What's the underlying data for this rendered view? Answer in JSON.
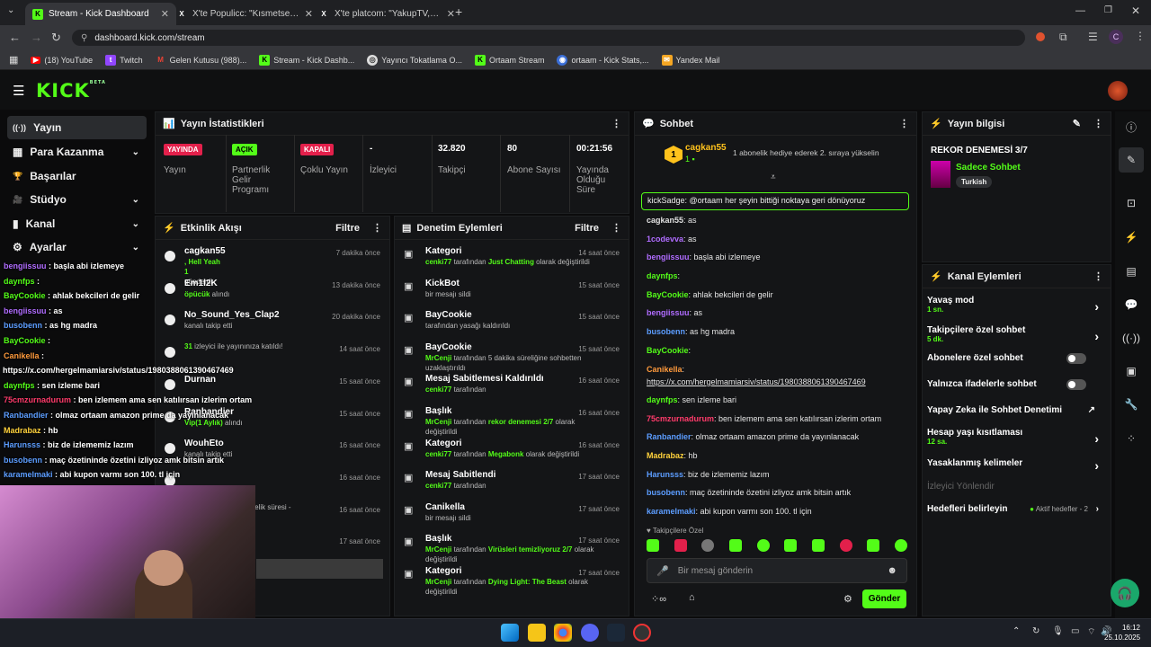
{
  "browser": {
    "tabs": [
      {
        "title": "Stream - Kick Dashboard",
        "close": "✕"
      },
      {
        "title": "X'te Populicc: \"Kısmetse Olur'u...",
        "close": "✕"
      },
      {
        "title": "X'te platcom: \"YakupTV, 120 bi...",
        "close": "✕"
      }
    ],
    "new_tab": "+",
    "url": "dashboard.kick.com/stream",
    "profile": "C",
    "bookmarks": [
      "(18) YouTube",
      "Twitch",
      "Gelen Kutusu (988)...",
      "Stream - Kick Dashb...",
      "Yayıncı Tokatlama O...",
      "Ortaam Stream",
      "ortaam - Kick Stats,...",
      "Yandex Mail"
    ]
  },
  "kick": {
    "logo": "KICK",
    "beta": "BETA"
  },
  "nav": {
    "items": [
      {
        "label": "Yayın",
        "icon": "((·))"
      },
      {
        "label": "Para Kazanma",
        "icon": "▦"
      },
      {
        "label": "Başarılar",
        "icon": "🏆"
      },
      {
        "label": "Stüdyo",
        "icon": "🎥"
      },
      {
        "label": "Kanal",
        "icon": "▮"
      },
      {
        "label": "Ayarlar",
        "icon": "⚙"
      }
    ]
  },
  "stats": {
    "title": "Yayın İstatistikleri",
    "cards": [
      {
        "badge": "YAYINDA",
        "label": "Yayın"
      },
      {
        "badge": "AÇIK",
        "label": "Partnerlik Gelir Programı"
      },
      {
        "badge": "KAPALI",
        "label": "Çoklu Yayın"
      },
      {
        "value": "-",
        "label": "İzleyici"
      },
      {
        "value": "32.820",
        "label": "Takipçi"
      },
      {
        "value": "80",
        "label": "Abone Sayısı"
      },
      {
        "value": "00:21:56",
        "label": "Yayında Olduğu Süre"
      }
    ]
  },
  "events": {
    "title": "Etkinlik Akışı",
    "filter": "Filtre",
    "rows": [
      {
        "user": "cagkan55",
        "l1": ", Hell Yeah",
        "l2": "1",
        "l3": "gönderdi",
        "time": "7 dakika önce"
      },
      {
        "user": "Em1l2K",
        "l1": "öpücük",
        "l3": " alındı",
        "time": "13 dakika önce"
      },
      {
        "user": "No_Sound_Yes_Clap2",
        "l3": "kanalı takip etti",
        "time": "20 dakika önce"
      },
      {
        "user": "",
        "l1": "31",
        "l3": " izleyici ile yayınınıza katıldı!",
        "time": "14 saat önce"
      },
      {
        "user": "Durnan",
        "l3": "",
        "time": "15 saat önce"
      },
      {
        "user": "Ranbandier",
        "l1": "Vip(1 Aylık)",
        "l3": " alındı",
        "time": "15 saat önce"
      },
      {
        "user": "WouhEto",
        "l3": "kanalı takip etti",
        "time": "16 saat önce"
      },
      {
        "user": "",
        "l3": "",
        "time": "16 saat önce"
      },
      {
        "user": "",
        "l3": "kutluyor! Toplam abonelik süresi -",
        "time": "16 saat önce"
      },
      {
        "user": "",
        "l3": "",
        "time": "17 saat önce"
      }
    ]
  },
  "mod": {
    "title": "Denetim Eylemleri",
    "filter": "Filtre",
    "rows": [
      {
        "t": "Kategori",
        "u": "cenki77",
        "d": " tarafından ",
        "h": "Just Chatting",
        "e": " olarak değiştirildi",
        "time": "14 saat önce"
      },
      {
        "t": "KickBot",
        "u": "",
        "d": "bir mesajı sildi",
        "h": "",
        "e": "",
        "time": "15 saat önce"
      },
      {
        "t": "BayCookie",
        "u": "",
        "d": "tarafından yasağı kaldırıldı",
        "h": "",
        "e": "",
        "time": "15 saat önce"
      },
      {
        "t": "BayCookie",
        "u": "MrCenji",
        "d": " tarafından 5 dakika süreliğine sohbetten uzaklaştırıldı",
        "h": "",
        "e": "",
        "time": "15 saat önce"
      },
      {
        "t": "Mesaj Sabitlemesi Kaldırıldı",
        "u": "cenki77",
        "d": " tarafından",
        "h": "",
        "e": "",
        "time": "16 saat önce"
      },
      {
        "t": "Başlık",
        "u": "MrCenji",
        "d": " tarafından ",
        "h": "rekor denemesi 2/7",
        "e": " olarak değiştirildi",
        "time": "16 saat önce"
      },
      {
        "t": "Kategori",
        "u": "cenki77",
        "d": " tarafından ",
        "h": "Megabonk",
        "e": " olarak değiştirildi",
        "time": "16 saat önce"
      },
      {
        "t": "Mesaj Sabitlendi",
        "u": "cenki77",
        "d": " tarafından",
        "h": "",
        "e": "",
        "time": "17 saat önce"
      },
      {
        "t": "Canikella",
        "u": "",
        "d": "bir mesajı sildi",
        "h": "",
        "e": "",
        "time": "17 saat önce"
      },
      {
        "t": "Başlık",
        "u": "MrCenji",
        "d": " tarafından ",
        "h": "Virüsleri temizliyoruz 2/7",
        "e": " olarak değiştirildi",
        "time": "17 saat önce"
      },
      {
        "t": "Kategori",
        "u": "MrCenji",
        "d": " tarafından ",
        "h": "Dying Light: The Beast",
        "e": " olarak değiştirildi",
        "time": "17 saat önce"
      }
    ]
  },
  "chat": {
    "title": "Sohbet",
    "top_user": "cagkan55",
    "top_count": "1",
    "gift": "1 abonelik hediye ederek 2. sıraya yükselin",
    "pinned": "kickSadge: @ortaam her şeyin bittiği noktaya geri dönüyoruz",
    "lines": [
      {
        "u": "cagkan55",
        "m": ": as",
        "c": "#e0e0e0"
      },
      {
        "u": "1codevva",
        "m": ": as",
        "c": "#b06cff"
      },
      {
        "u": "bengiissuu",
        "m": ": başla abi izlemeye",
        "c": "#b06cff"
      },
      {
        "u": "daynfps",
        "m": ":",
        "c": "#53fc18"
      },
      {
        "u": "BayCookie",
        "m": ": ahlak bekcileri de gelir",
        "c": "#53fc18"
      },
      {
        "u": "bengiissuu",
        "m": ": as",
        "c": "#b06cff"
      },
      {
        "u": "busobenn",
        "m": ": as hg madra",
        "c": "#5c9dff"
      },
      {
        "u": "BayCookie",
        "m": ":",
        "c": "#53fc18"
      },
      {
        "u": "Canikella",
        "m": ":",
        "c": "#ff9a3c"
      },
      {
        "u": "",
        "m": "https://x.com/hergelmamiarsiv/status/1980388061390467469",
        "c": "#fff"
      },
      {
        "u": "daynfps",
        "m": ": sen izleme bari",
        "c": "#53fc18"
      },
      {
        "u": "75cmzurnadurum",
        "m": ": ben izlemem ama sen katılırsan izlerim ortam",
        "c": "#ff3b6b"
      },
      {
        "u": "Ranbandier",
        "m": ": olmaz ortaam amazon prime da yayınlanacak",
        "c": "#5c9dff"
      },
      {
        "u": "Madrabaz",
        "m": ": hb",
        "c": "#ffd23c"
      },
      {
        "u": "Harunsss",
        "m": ": biz de izlememiz lazım",
        "c": "#5c9dff"
      },
      {
        "u": "busobenn",
        "m": ": maç özetininde özetini izliyoz amk bitsin artık",
        "c": "#5c9dff"
      },
      {
        "u": "karamelmaki",
        "m": ": abi kupon varmı son 100. tl için",
        "c": "#5c9dff"
      }
    ],
    "followers_label": "Takipçilere Özel",
    "placeholder": "Bir mesaj gönderin",
    "send": "Gönder"
  },
  "info": {
    "title": "Yayın bilgisi",
    "stream_title": "REKOR DENEMESİ 3/7",
    "category": "Sadece Sohbet",
    "tag": "Turkish"
  },
  "channel": {
    "title": "Kanal Eylemleri",
    "rows": [
      {
        "l": "Yavaş mod",
        "s": "1 sn."
      },
      {
        "l": "Takipçilere özel sohbet",
        "s": "5 dk."
      },
      {
        "l": "Abonelere özel sohbet",
        "s": ""
      },
      {
        "l": "Yalnızca ifadelerle sohbet",
        "s": ""
      },
      {
        "l": "Yapay Zeka ile Sohbet Denetimi",
        "s": ""
      },
      {
        "l": "Hesap yaşı kısıtlaması",
        "s": "12 sa."
      },
      {
        "l": "Yasaklanmış kelimeler",
        "s": ""
      },
      {
        "l": "İzleyici Yönlendir",
        "s": ""
      },
      {
        "l": "Hedefleri belirleyin",
        "s": ""
      }
    ],
    "goal_note": "Aktif hedefler - 2"
  },
  "overlay": [
    {
      "u": "bengiissuu",
      "m": " : başla abi izlemeye",
      "c": "#b06cff"
    },
    {
      "u": "daynfps",
      "m": " :",
      "c": "#53fc18"
    },
    {
      "u": "BayCookie",
      "m": " : ahlak bekcileri de gelir",
      "c": "#53fc18"
    },
    {
      "u": "bengiissuu",
      "m": " : as",
      "c": "#b06cff"
    },
    {
      "u": "busobenn",
      "m": " : as hg madra",
      "c": "#5c9dff"
    },
    {
      "u": "BayCookie",
      "m": " :",
      "c": "#53fc18"
    },
    {
      "u": "Canikella",
      "m": " :",
      "c": "#ff9a3c"
    },
    {
      "u": "",
      "m": "https://x.com/hergelmamiarsiv/status/1980388061390467469",
      "c": "#fff"
    },
    {
      "u": "daynfps",
      "m": " : sen izleme bari",
      "c": "#53fc18"
    },
    {
      "u": "75cmzurnadurum",
      "m": " : ben izlemem ama sen katılırsan izlerim ortam",
      "c": "#ff3b6b"
    },
    {
      "u": "Ranbandier",
      "m": " : olmaz ortaam amazon prime da yayınlanacak",
      "c": "#5c9dff"
    },
    {
      "u": "Madrabaz",
      "m": " : hb",
      "c": "#ffd23c"
    },
    {
      "u": "Harunsss",
      "m": " : biz de izlememiz lazım",
      "c": "#5c9dff"
    },
    {
      "u": "busobenn",
      "m": " : maç özetininde özetini izliyoz amk bitsin artık",
      "c": "#5c9dff"
    },
    {
      "u": "karamelmaki",
      "m": " : abi kupon varmı son 100. tl için",
      "c": "#5c9dff"
    }
  ],
  "taskbar": {
    "time": "16:12",
    "date": "25.10.2025"
  }
}
